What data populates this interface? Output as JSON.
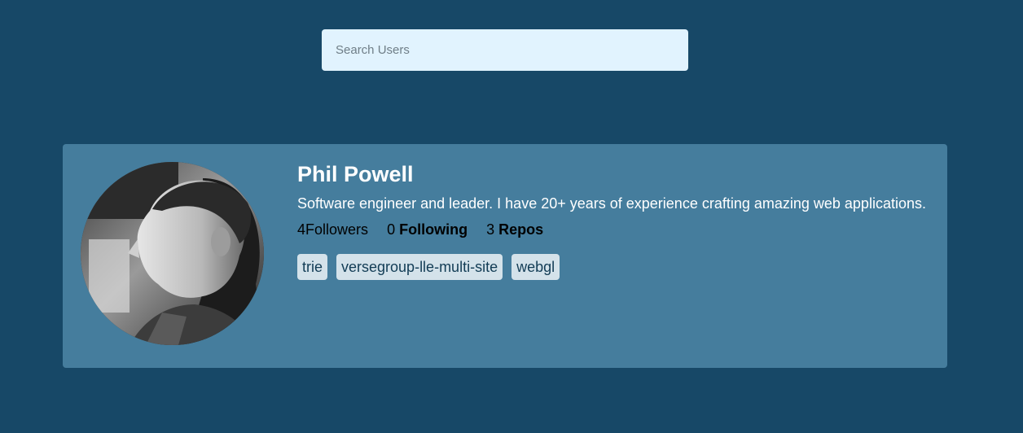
{
  "search": {
    "placeholder": "Search Users",
    "value": ""
  },
  "profile": {
    "name": "Phil Powell",
    "bio": "Software engineer and leader. I have 20+ years of experience crafting amazing web applications.",
    "followers_count": "4",
    "followers_label": "Followers",
    "following_count": "0",
    "following_label": "Following",
    "repos_count": "3",
    "repos_label": "Repos",
    "repos": [
      {
        "name": "trie"
      },
      {
        "name": "versegroup-lle-multi-site"
      },
      {
        "name": "webgl"
      }
    ]
  },
  "colors": {
    "background": "#174867",
    "card": "#457d9d",
    "search_bg": "#e1f3fe",
    "tag_bg": "#d4e2ea"
  }
}
